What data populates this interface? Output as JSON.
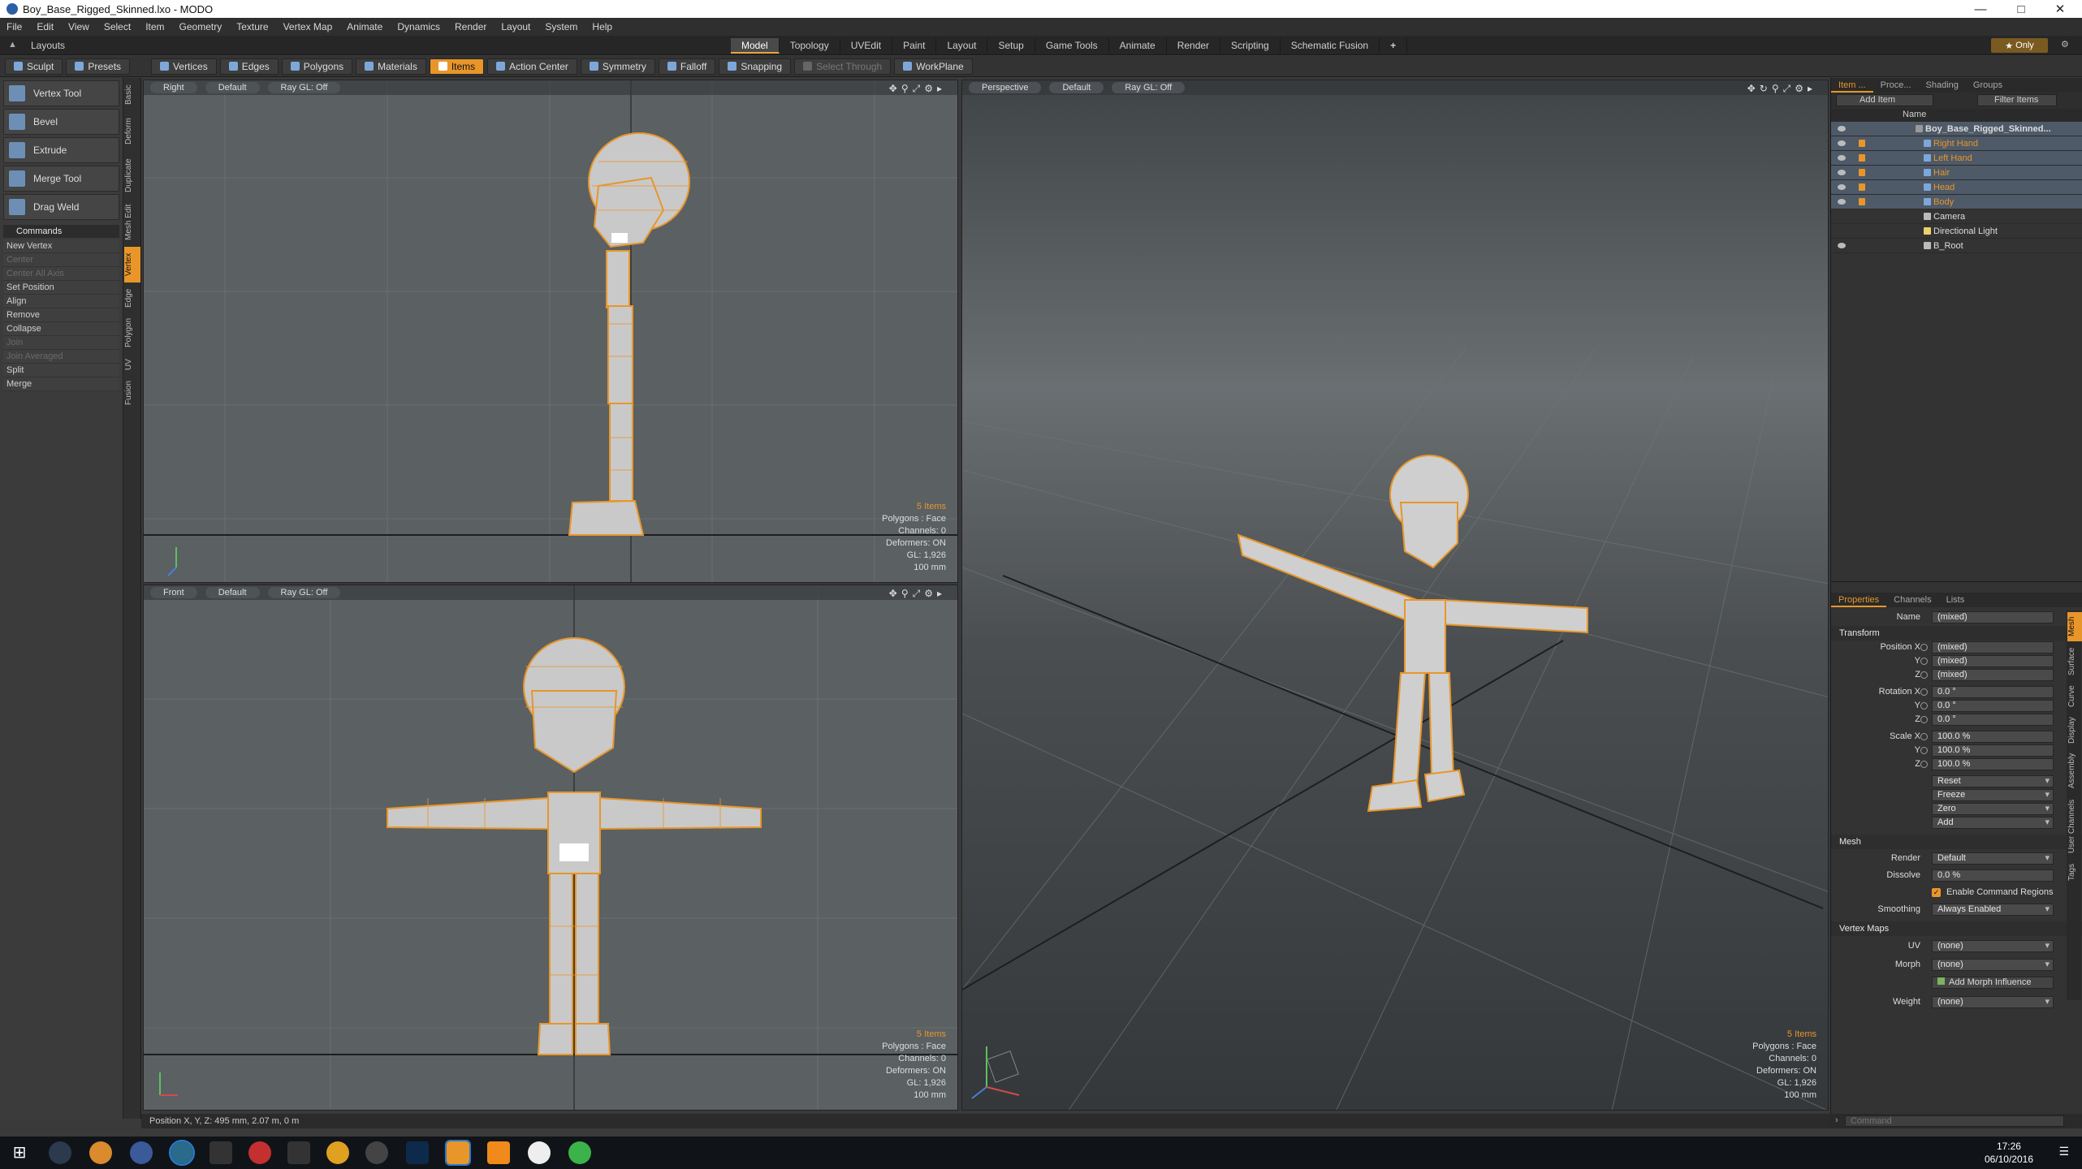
{
  "window": {
    "title": "Boy_Base_Rigged_Skinned.lxo - MODO"
  },
  "menu": [
    "File",
    "Edit",
    "View",
    "Select",
    "Item",
    "Geometry",
    "Texture",
    "Vertex Map",
    "Animate",
    "Dynamics",
    "Render",
    "Layout",
    "System",
    "Help"
  ],
  "layouts": {
    "label": "Layouts",
    "only": "Only",
    "tabs": [
      "Model",
      "Topology",
      "UVEdit",
      "Paint",
      "Layout",
      "Setup",
      "Game Tools",
      "Animate",
      "Render",
      "Scripting",
      "Schematic Fusion"
    ]
  },
  "toolbar": {
    "sculpt": "Sculpt",
    "presets": "Presets",
    "vertices": "Vertices",
    "edges": "Edges",
    "polygons": "Polygons",
    "materials": "Materials",
    "items": "Items",
    "action_center": "Action Center",
    "symmetry": "Symmetry",
    "falloff": "Falloff",
    "snapping": "Snapping",
    "select_through": "Select Through",
    "workplane": "WorkPlane"
  },
  "tools": [
    "Vertex Tool",
    "Bevel",
    "Extrude",
    "Merge Tool",
    "Drag Weld"
  ],
  "commands": {
    "header": "Commands",
    "items": [
      {
        "label": "New Vertex",
        "enabled": true
      },
      {
        "label": "Center",
        "enabled": false
      },
      {
        "label": "Center All Axis",
        "enabled": false
      },
      {
        "label": "Set Position",
        "enabled": true
      },
      {
        "label": "Align",
        "enabled": true
      },
      {
        "label": "Remove",
        "enabled": true
      },
      {
        "label": "Collapse",
        "enabled": true
      },
      {
        "label": "Join",
        "enabled": false
      },
      {
        "label": "Join Averaged",
        "enabled": false
      },
      {
        "label": "Split",
        "enabled": true
      },
      {
        "label": "Merge",
        "enabled": true
      }
    ]
  },
  "vtabs": [
    "Basic",
    "Deform",
    "Duplicate",
    "Mesh Edit",
    "Vertex",
    "Edge",
    "Polygon",
    "UV",
    "Fusion"
  ],
  "viewports": {
    "right": {
      "view": "Right",
      "shading": "Default",
      "ray": "Ray GL: Off",
      "items": "5 Items",
      "polys": "Polygons : Face",
      "channels": "Channels: 0",
      "deformers": "Deformers: ON",
      "gl": "GL: 1,926",
      "scale": "100 mm"
    },
    "front": {
      "view": "Front",
      "shading": "Default",
      "ray": "Ray GL: Off",
      "items": "5 Items",
      "polys": "Polygons : Face",
      "channels": "Channels: 0",
      "deformers": "Deformers: ON",
      "gl": "GL: 1,926",
      "scale": "100 mm"
    },
    "persp": {
      "view": "Perspective",
      "shading": "Default",
      "ray": "Ray GL: Off",
      "items": "5 Items",
      "polys": "Polygons : Face",
      "channels": "Channels: 0",
      "deformers": "Deformers: ON",
      "gl": "GL: 1,926",
      "scale": "100 mm"
    }
  },
  "status": {
    "position": "Position X, Y, Z:  495 mm, 2.07 m, 0 m"
  },
  "itemlist": {
    "tabs": [
      "Item ...",
      "Proce...",
      "Shading",
      "Groups"
    ],
    "add_item": "Add Item",
    "filter": "Filter Items",
    "col_name": "Name",
    "items": [
      {
        "name": "Boy_Base_Rigged_Skinned...",
        "level": 0,
        "selected": true,
        "orange": false
      },
      {
        "name": "Right Hand",
        "level": 1,
        "selected": true,
        "orange": true
      },
      {
        "name": "Left Hand",
        "level": 1,
        "selected": true,
        "orange": true
      },
      {
        "name": "Hair",
        "level": 1,
        "selected": true,
        "orange": true
      },
      {
        "name": "Head",
        "level": 1,
        "selected": true,
        "orange": true
      },
      {
        "name": "Body",
        "level": 1,
        "selected": true,
        "orange": true
      },
      {
        "name": "Camera",
        "level": 1,
        "selected": false,
        "orange": false
      },
      {
        "name": "Directional Light",
        "level": 1,
        "selected": false,
        "orange": false
      },
      {
        "name": "B_Root",
        "level": 1,
        "selected": false,
        "orange": false
      }
    ]
  },
  "properties": {
    "tabs": [
      "Properties",
      "Channels",
      "Lists"
    ],
    "name_label": "Name",
    "name_value": "(mixed)",
    "transform": "Transform",
    "position_x": "Position X",
    "pos_x": "(mixed)",
    "pos_y": "(mixed)",
    "pos_z": "(mixed)",
    "rotation_x": "Rotation X",
    "rot_x": "0.0 °",
    "rot_y": "0.0 °",
    "rot_z": "0.0 °",
    "scale_x": "Scale X",
    "scl_x": "100.0 %",
    "scl_y": "100.0 %",
    "scl_z": "100.0 %",
    "y": "Y",
    "z": "Z",
    "reset": "Reset",
    "freeze": "Freeze",
    "zero": "Zero",
    "add": "Add",
    "mesh": "Mesh",
    "render_label": "Render",
    "render_value": "Default",
    "dissolve_label": "Dissolve",
    "dissolve_value": "0.0 %",
    "enable_cmd": "Enable Command Regions",
    "smoothing_label": "Smoothing",
    "smoothing_value": "Always Enabled",
    "vertex_maps": "Vertex Maps",
    "uv_label": "UV",
    "uv_value": "(none)",
    "morph_label": "Morph",
    "morph_value": "(none)",
    "add_morph": "Add Morph Influence",
    "weight_label": "Weight",
    "weight_value": "(none)",
    "side_tabs": [
      "Mesh",
      "Surface",
      "Curve",
      "Display",
      "Assembly",
      "User Channels",
      "Tags"
    ]
  },
  "command_input": {
    "placeholder": "Command"
  },
  "taskbar": {
    "time": "17:26",
    "date": "06/10/2016"
  },
  "colors": {
    "accent": "#e8962a",
    "selection": "#4e5a68",
    "viewport": "#5b6063"
  }
}
